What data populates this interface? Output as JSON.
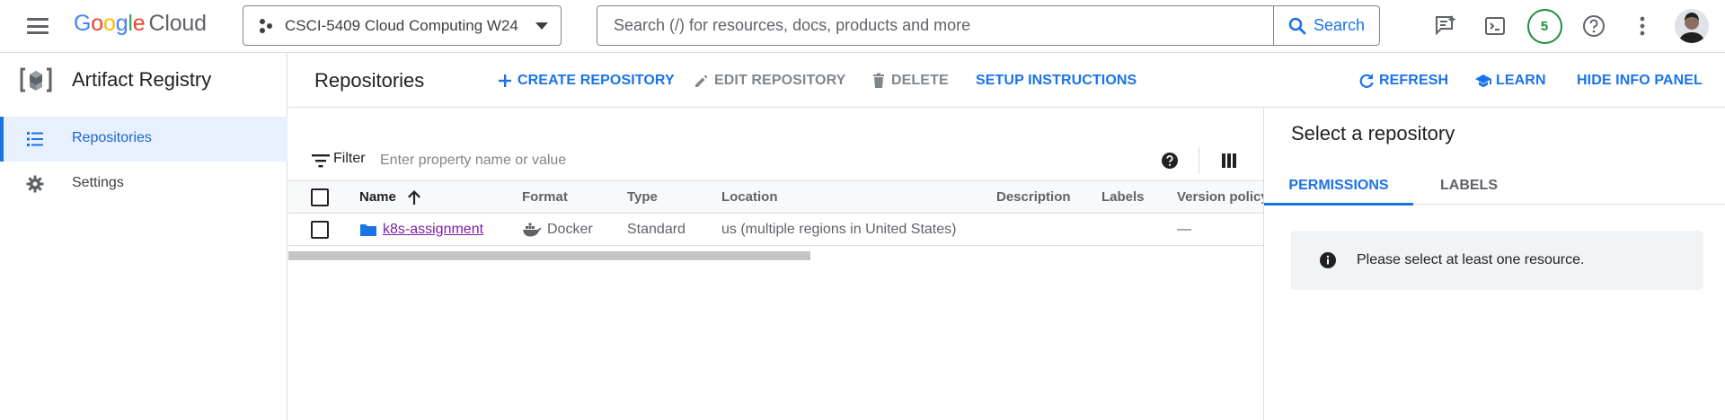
{
  "header": {
    "logo_google": [
      "G",
      "o",
      "o",
      "g",
      "l",
      "e"
    ],
    "logo_cloud": "Cloud",
    "project_name": "CSCI-5409 Cloud Computing W24",
    "search_placeholder": "Search (/) for resources, docs, products and more",
    "search_button": "Search",
    "notification_count": "5",
    "icons": [
      "menu-icon",
      "project-icon",
      "search-icon",
      "feedback-icon",
      "cloud-shell-icon",
      "help-icon",
      "more-vert-icon",
      "avatar"
    ]
  },
  "sidebar": {
    "product_title": "Artifact Registry",
    "items": [
      {
        "label": "Repositories",
        "icon": "list-icon",
        "active": true
      },
      {
        "label": "Settings",
        "icon": "gear-icon",
        "active": false
      }
    ]
  },
  "actionbar": {
    "title": "Repositories",
    "create": "CREATE REPOSITORY",
    "edit": "EDIT REPOSITORY",
    "delete": "DELETE",
    "setup": "SETUP INSTRUCTIONS",
    "refresh": "REFRESH",
    "learn": "LEARN",
    "hide_panel": "HIDE INFO PANEL"
  },
  "filter": {
    "label": "Filter",
    "placeholder": "Enter property name or value"
  },
  "table": {
    "columns": [
      "Name",
      "Format",
      "Type",
      "Location",
      "Description",
      "Labels",
      "Version policy"
    ],
    "sort": {
      "column": "Name",
      "direction": "ascending"
    },
    "rows": [
      {
        "name": "k8s-assignment",
        "format": "Docker",
        "type": "Standard",
        "location": "us (multiple regions in United States)",
        "description": "",
        "labels": "",
        "version_policy": "—"
      }
    ]
  },
  "info_panel": {
    "title": "Select a repository",
    "tabs": [
      "PERMISSIONS",
      "LABELS"
    ],
    "active_tab": "PERMISSIONS",
    "notice": "Please select at least one resource."
  },
  "colors": {
    "accent": "#1a73e8",
    "link_visited": "#7b1fa2",
    "active_nav_bg": "#e8f0fe",
    "badge": "#1e8e3e"
  }
}
